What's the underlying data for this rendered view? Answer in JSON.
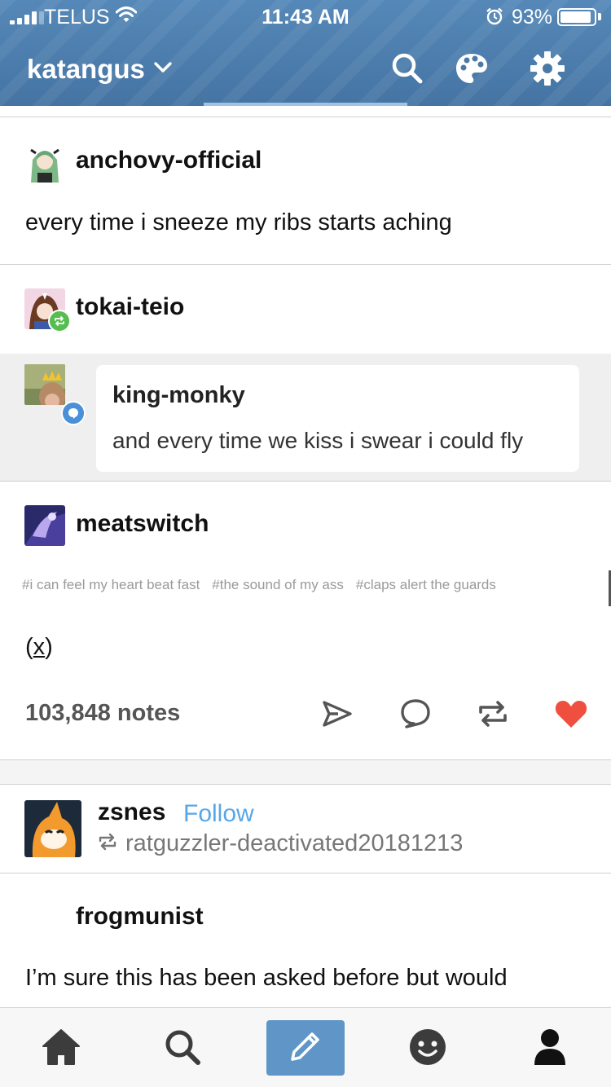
{
  "status_bar": {
    "carrier": "TELUS",
    "time": "11:43 AM",
    "battery_percent": "93%",
    "battery_level": 0.93
  },
  "header": {
    "blog_name": "katangus",
    "icons": [
      "search-icon",
      "palette-icon",
      "gear-icon"
    ]
  },
  "posts": {
    "first": {
      "username": "anchovy-official",
      "text": "every time i sneeze my ribs starts aching"
    },
    "second": {
      "username": "tokai-teio",
      "reply": {
        "username": "king-monky",
        "text": "and every time we kiss i swear i could fly"
      },
      "reblogger": "meatswitch",
      "tags": [
        "#i can feel my heart beat fast",
        "#the sound of my ass",
        "#claps alert the guards"
      ],
      "source_open": "(",
      "source_x": "x",
      "source_close": ")",
      "notes": "103,848 notes",
      "actions": [
        "share-icon",
        "reply-icon",
        "reblog-icon",
        "like-icon"
      ]
    },
    "third": {
      "username": "zsnes",
      "follow_label": "Follow",
      "reblogged_from": "ratguzzler-deactivated20181213",
      "op_username": "frogmunist",
      "text": "I’m sure this has been asked before but would"
    }
  },
  "colors": {
    "header": "#4b79a6",
    "follow": "#57a7e8",
    "like": "#ef4f3f",
    "reblog_badge": "#56bd4f",
    "reply_badge": "#4a90d9",
    "compose": "#5f96c7"
  },
  "tabbar": {
    "items": [
      "home-icon",
      "search-icon",
      "compose-icon",
      "activity-icon",
      "account-icon"
    ]
  }
}
